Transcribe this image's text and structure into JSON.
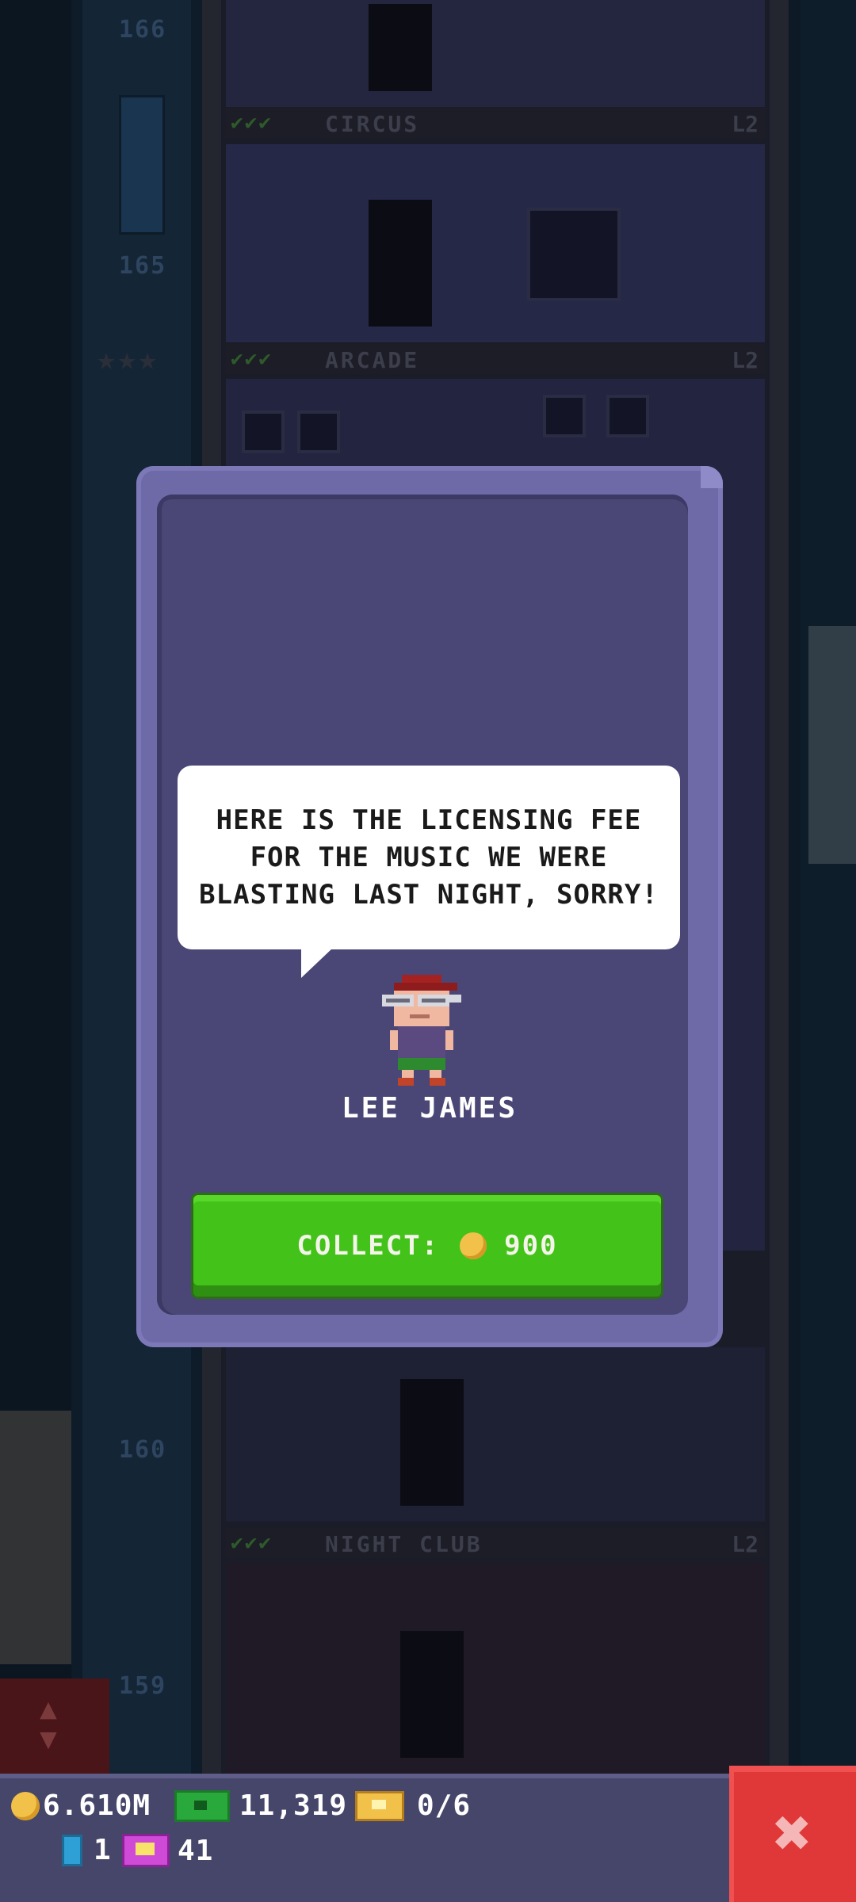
{
  "background": {
    "floors": [
      {
        "number": "166",
        "label": "CIRCUS",
        "level": "L2"
      },
      {
        "number": "165",
        "label": "ARCADE",
        "level": "L2"
      },
      {
        "number": "160",
        "label": "NIGHT CLUB",
        "level": "L2"
      },
      {
        "number": "159",
        "label": "",
        "level": ""
      }
    ],
    "checkmarks": "✔✔✔"
  },
  "dialog": {
    "message": "HERE IS THE LICENSING FEE FOR THE MUSIC WE WERE BLASTING LAST NIGHT, SORRY!",
    "character_name": "LEE JAMES",
    "collect_label": "COLLECT:",
    "collect_amount": "900",
    "collect_icon": "coin-icon"
  },
  "hud": {
    "coins": "6.610M",
    "bux": "11,319",
    "tickets": "0/6",
    "keys": "1",
    "tv_tokens": "41",
    "close_icon": "close-icon"
  },
  "colors": {
    "collect_button": "#43c21a",
    "close_button": "#e03838",
    "dialog_frame": "#6e6aa8",
    "dialog_inner": "#4a4776"
  }
}
